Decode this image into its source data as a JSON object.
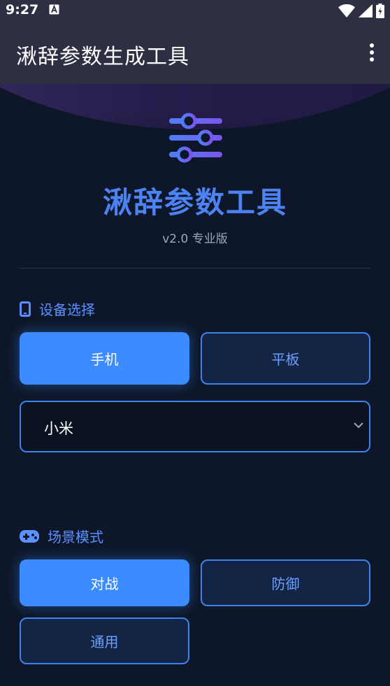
{
  "status_bar": {
    "time": "9:27",
    "icons": [
      "accessibility-a-icon",
      "wifi-icon",
      "signal-icon",
      "battery-charging-icon"
    ]
  },
  "app_bar": {
    "title": "湫辞参数生成工具",
    "menu_icon": "more-vert-icon"
  },
  "hero": {
    "icon": "sliders-icon",
    "title": "湫辞参数工具",
    "version": "v2.0 专业版"
  },
  "device_section": {
    "heading": "设备选择",
    "icon": "phone-icon",
    "options": [
      {
        "label": "手机",
        "selected": true
      },
      {
        "label": "平板",
        "selected": false
      }
    ],
    "brand_select": {
      "value": "小米"
    }
  },
  "scene_section": {
    "heading": "场景模式",
    "icon": "gamepad-icon",
    "options": [
      {
        "label": "对战",
        "selected": true
      },
      {
        "label": "防御",
        "selected": false
      },
      {
        "label": "通用",
        "selected": false
      }
    ]
  },
  "colors": {
    "accent": "#3c8cff",
    "title_blue": "#4d82f2",
    "background": "#0e1729",
    "app_bar": "#2f2f44",
    "hero_arc": "#3a2f63"
  }
}
